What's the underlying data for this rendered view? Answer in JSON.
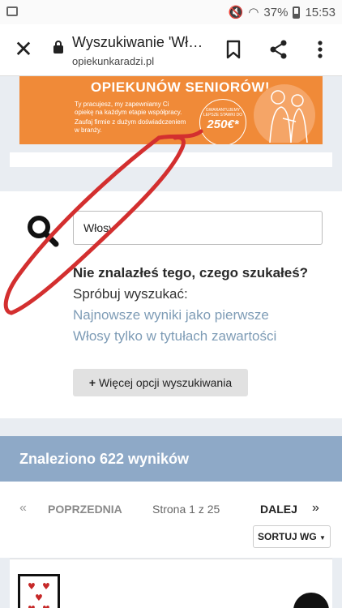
{
  "status_bar": {
    "battery": "37%",
    "time": "15:53"
  },
  "toolbar": {
    "title": "Wyszukiwanie 'Włosy'",
    "url": "opiekunkaradzi.pl"
  },
  "banner": {
    "headline": "OPIEKUNÓW SENIORÓW!",
    "text1": "Ty pracujesz, my zapewniamy Ci opiekę na każdym etapie współpracy.",
    "text2": "Zaufaj firmie z dużym doświadczeniem w branży.",
    "badge_small": "GWARANTUJEMY LEPSZE STAWKI DO",
    "badge_amount": "250€*"
  },
  "search": {
    "query": "Włosy",
    "not_found_title": "Nie znalazłeś tego, czego szukałeś?",
    "try_label": "Spróbuj wyszukać:",
    "links": [
      "Najnowsze wyniki jako pierwsze",
      "Włosy tylko w tytułach zawartości"
    ],
    "more_options": "Więcej opcji wyszukiwania",
    "more_icon": "+"
  },
  "results": {
    "count_label": "Znaleziono 622 wyników"
  },
  "pagination": {
    "first": "«",
    "prev": "POPRZEDNIA",
    "info": "Strona 1 z 25",
    "next": "DALEJ",
    "last": "»",
    "sort": "SORTUJ WG"
  },
  "colors": {
    "banner": "#f08a38",
    "results_header": "#8ea9c7",
    "link": "#7e9cb6",
    "annotation": "#d32f2f"
  }
}
